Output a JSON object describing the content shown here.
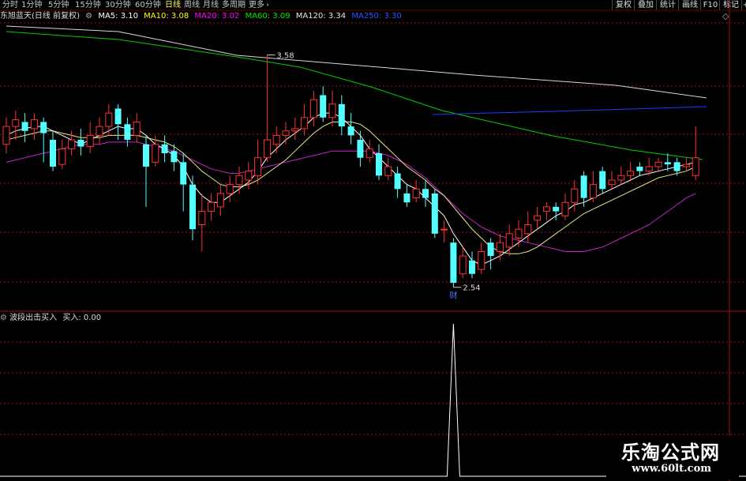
{
  "periods": [
    {
      "label": "分时",
      "active": false
    },
    {
      "label": "1分钟",
      "active": false
    },
    {
      "label": "5分钟",
      "active": false
    },
    {
      "label": "15分钟",
      "active": false
    },
    {
      "label": "30分钟",
      "active": false
    },
    {
      "label": "60分钟",
      "active": false
    },
    {
      "label": "日线",
      "active": true
    },
    {
      "label": "周线",
      "active": false
    },
    {
      "label": "月线",
      "active": false
    },
    {
      "label": "多周期",
      "active": false
    },
    {
      "label": "更多",
      "active": false
    }
  ],
  "right_buttons": [
    "复权",
    "叠加",
    "统计",
    "画线",
    "F10",
    "标记",
    "+自选"
  ],
  "diamond": "◇",
  "title": "东旭蓝天(日线 前复权)",
  "ma": {
    "ma5": {
      "label": "MA5: 3.10",
      "color": "#ffffff"
    },
    "ma10": {
      "label": "MA10: 3.08",
      "color": "#ffff00"
    },
    "ma20": {
      "label": "MA20: 3.02",
      "color": "#ff00ff"
    },
    "ma60": {
      "label": "MA60: 3.09",
      "color": "#00e600"
    },
    "ma120": {
      "label": "MA120: 3.34",
      "color": "#e6e6e6"
    },
    "ma250": {
      "label": "MA250: 3.30",
      "color": "#2255ff"
    }
  },
  "annotations": {
    "high": "3.58",
    "low": "2.54",
    "marker": "财"
  },
  "indicator": {
    "name": "波段出击买入",
    "value_label": "买入: 0.00"
  },
  "watermark": {
    "name": "乐淘公式网",
    "url": "www.60lt.com"
  },
  "chart_data": {
    "type": "candlestick",
    "ylim": [
      2.44,
      3.72
    ],
    "candles": [
      [
        3.18,
        3.26,
        3.3,
        3.14
      ],
      [
        3.26,
        3.29,
        3.33,
        3.2
      ],
      [
        3.28,
        3.24,
        3.32,
        3.19
      ],
      [
        3.25,
        3.29,
        3.32,
        3.2
      ],
      [
        3.28,
        3.23,
        3.3,
        3.1
      ],
      [
        3.2,
        3.08,
        3.24,
        3.06
      ],
      [
        3.09,
        3.16,
        3.2,
        3.07
      ],
      [
        3.16,
        3.2,
        3.24,
        3.13
      ],
      [
        3.2,
        3.17,
        3.25,
        3.13
      ],
      [
        3.17,
        3.22,
        3.28,
        3.14
      ],
      [
        3.22,
        3.26,
        3.3,
        3.18
      ],
      [
        3.26,
        3.32,
        3.36,
        3.22
      ],
      [
        3.34,
        3.27,
        3.36,
        3.2
      ],
      [
        3.27,
        3.2,
        3.3,
        3.17
      ],
      [
        3.22,
        3.28,
        3.32,
        3.19
      ],
      [
        3.18,
        3.08,
        3.22,
        2.9
      ],
      [
        3.1,
        3.18,
        3.22,
        3.08
      ],
      [
        3.18,
        3.14,
        3.22,
        3.1
      ],
      [
        3.15,
        3.1,
        3.18,
        3.06
      ],
      [
        3.1,
        3.0,
        3.14,
        2.88
      ],
      [
        3.0,
        2.8,
        3.04,
        2.75
      ],
      [
        2.82,
        2.88,
        2.96,
        2.7
      ],
      [
        2.88,
        2.92,
        2.96,
        2.84
      ],
      [
        2.9,
        2.96,
        3.0,
        2.86
      ],
      [
        2.96,
        3.0,
        3.04,
        2.92
      ],
      [
        3.0,
        3.04,
        3.08,
        2.96
      ],
      [
        3.02,
        3.06,
        3.1,
        2.98
      ],
      [
        3.04,
        3.12,
        3.2,
        3.0
      ],
      [
        3.12,
        3.2,
        3.58,
        3.1
      ],
      [
        3.18,
        3.22,
        3.26,
        3.14
      ],
      [
        3.22,
        3.24,
        3.28,
        3.18
      ],
      [
        3.24,
        3.25,
        3.3,
        3.2
      ],
      [
        3.25,
        3.3,
        3.36,
        3.22
      ],
      [
        3.3,
        3.38,
        3.42,
        3.26
      ],
      [
        3.4,
        3.3,
        3.44,
        3.28
      ],
      [
        3.3,
        3.36,
        3.42,
        3.26
      ],
      [
        3.36,
        3.26,
        3.4,
        3.22
      ],
      [
        3.26,
        3.22,
        3.32,
        3.18
      ],
      [
        3.2,
        3.12,
        3.24,
        3.08
      ],
      [
        3.12,
        3.16,
        3.2,
        3.1
      ],
      [
        3.14,
        3.04,
        3.18,
        3.02
      ],
      [
        3.04,
        3.08,
        3.12,
        3.02
      ],
      [
        3.05,
        2.98,
        3.08,
        2.94
      ],
      [
        2.96,
        2.92,
        3.0,
        2.9
      ],
      [
        2.94,
        2.98,
        3.02,
        2.92
      ],
      [
        2.98,
        2.94,
        3.02,
        2.9
      ],
      [
        2.96,
        2.78,
        2.98,
        2.76
      ],
      [
        2.8,
        2.8,
        2.84,
        2.74
      ],
      [
        2.74,
        2.56,
        2.76,
        2.54
      ],
      [
        2.6,
        2.68,
        2.72,
        2.58
      ],
      [
        2.66,
        2.6,
        2.7,
        2.58
      ],
      [
        2.62,
        2.7,
        2.74,
        2.6
      ],
      [
        2.74,
        2.68,
        2.76,
        2.62
      ],
      [
        2.7,
        2.74,
        2.78,
        2.66
      ],
      [
        2.72,
        2.78,
        2.82,
        2.68
      ],
      [
        2.76,
        2.8,
        2.84,
        2.72
      ],
      [
        2.78,
        2.82,
        2.88,
        2.74
      ],
      [
        2.84,
        2.86,
        2.9,
        2.8
      ],
      [
        2.88,
        2.9,
        2.92,
        2.84
      ],
      [
        2.9,
        2.88,
        2.92,
        2.84
      ],
      [
        2.86,
        2.92,
        2.96,
        2.84
      ],
      [
        2.92,
        2.98,
        3.02,
        2.88
      ],
      [
        3.04,
        2.94,
        3.06,
        2.9
      ],
      [
        2.94,
        3.0,
        3.06,
        2.92
      ],
      [
        3.06,
        2.98,
        3.08,
        2.96
      ],
      [
        3.0,
        3.02,
        3.06,
        2.98
      ],
      [
        3.02,
        3.04,
        3.08,
        3.0
      ],
      [
        3.04,
        3.06,
        3.1,
        3.02
      ],
      [
        3.08,
        3.06,
        3.1,
        3.04
      ],
      [
        3.06,
        3.08,
        3.12,
        3.04
      ],
      [
        3.08,
        3.1,
        3.12,
        3.06
      ],
      [
        3.1,
        3.09,
        3.14,
        3.06
      ],
      [
        3.1,
        3.06,
        3.12,
        3.04
      ],
      [
        3.08,
        3.09,
        3.12,
        3.06
      ],
      [
        3.04,
        3.12,
        3.26,
        3.02
      ]
    ],
    "ma5": [
      3.22,
      3.24,
      3.25,
      3.26,
      3.26,
      3.24,
      3.22,
      3.2,
      3.18,
      3.2,
      3.22,
      3.24,
      3.26,
      3.25,
      3.25,
      3.22,
      3.18,
      3.16,
      3.13,
      3.08,
      3.0,
      2.95,
      2.92,
      2.92,
      2.95,
      2.98,
      3.01,
      3.06,
      3.12,
      3.16,
      3.2,
      3.23,
      3.26,
      3.3,
      3.32,
      3.32,
      3.3,
      3.26,
      3.22,
      3.16,
      3.12,
      3.08,
      3.04,
      3.0,
      2.98,
      2.94,
      2.9,
      2.86,
      2.78,
      2.72,
      2.66,
      2.64,
      2.66,
      2.68,
      2.71,
      2.74,
      2.77,
      2.8,
      2.83,
      2.86,
      2.88,
      2.91,
      2.92,
      2.94,
      2.96,
      2.98,
      3.0,
      3.02,
      3.04,
      3.05,
      3.06,
      3.07,
      3.08,
      3.09,
      3.1
    ],
    "ma10": [
      3.2,
      3.21,
      3.22,
      3.23,
      3.24,
      3.24,
      3.23,
      3.22,
      3.21,
      3.21,
      3.21,
      3.22,
      3.22,
      3.22,
      3.22,
      3.21,
      3.2,
      3.19,
      3.17,
      3.14,
      3.1,
      3.06,
      3.03,
      3.0,
      2.99,
      2.99,
      3.0,
      3.02,
      3.05,
      3.08,
      3.11,
      3.15,
      3.19,
      3.23,
      3.26,
      3.28,
      3.28,
      3.28,
      3.27,
      3.24,
      3.2,
      3.16,
      3.12,
      3.08,
      3.05,
      3.02,
      2.98,
      2.95,
      2.9,
      2.85,
      2.8,
      2.76,
      2.72,
      2.7,
      2.69,
      2.69,
      2.7,
      2.72,
      2.75,
      2.78,
      2.81,
      2.84,
      2.87,
      2.89,
      2.91,
      2.93,
      2.95,
      2.97,
      2.99,
      3.01,
      3.03,
      3.04,
      3.05,
      3.06,
      3.08
    ],
    "ma20": [
      3.1,
      3.11,
      3.12,
      3.13,
      3.14,
      3.15,
      3.16,
      3.17,
      3.18,
      3.18,
      3.18,
      3.19,
      3.19,
      3.19,
      3.19,
      3.18,
      3.17,
      3.16,
      3.15,
      3.13,
      3.11,
      3.09,
      3.07,
      3.06,
      3.05,
      3.05,
      3.06,
      3.07,
      3.08,
      3.09,
      3.1,
      3.11,
      3.12,
      3.13,
      3.14,
      3.15,
      3.15,
      3.15,
      3.15,
      3.15,
      3.14,
      3.13,
      3.11,
      3.09,
      3.06,
      3.03,
      2.99,
      2.95,
      2.91,
      2.87,
      2.84,
      2.81,
      2.79,
      2.77,
      2.76,
      2.75,
      2.74,
      2.73,
      2.72,
      2.71,
      2.7,
      2.7,
      2.7,
      2.71,
      2.72,
      2.74,
      2.76,
      2.78,
      2.8,
      2.82,
      2.85,
      2.88,
      2.91,
      2.94,
      2.96
    ]
  }
}
